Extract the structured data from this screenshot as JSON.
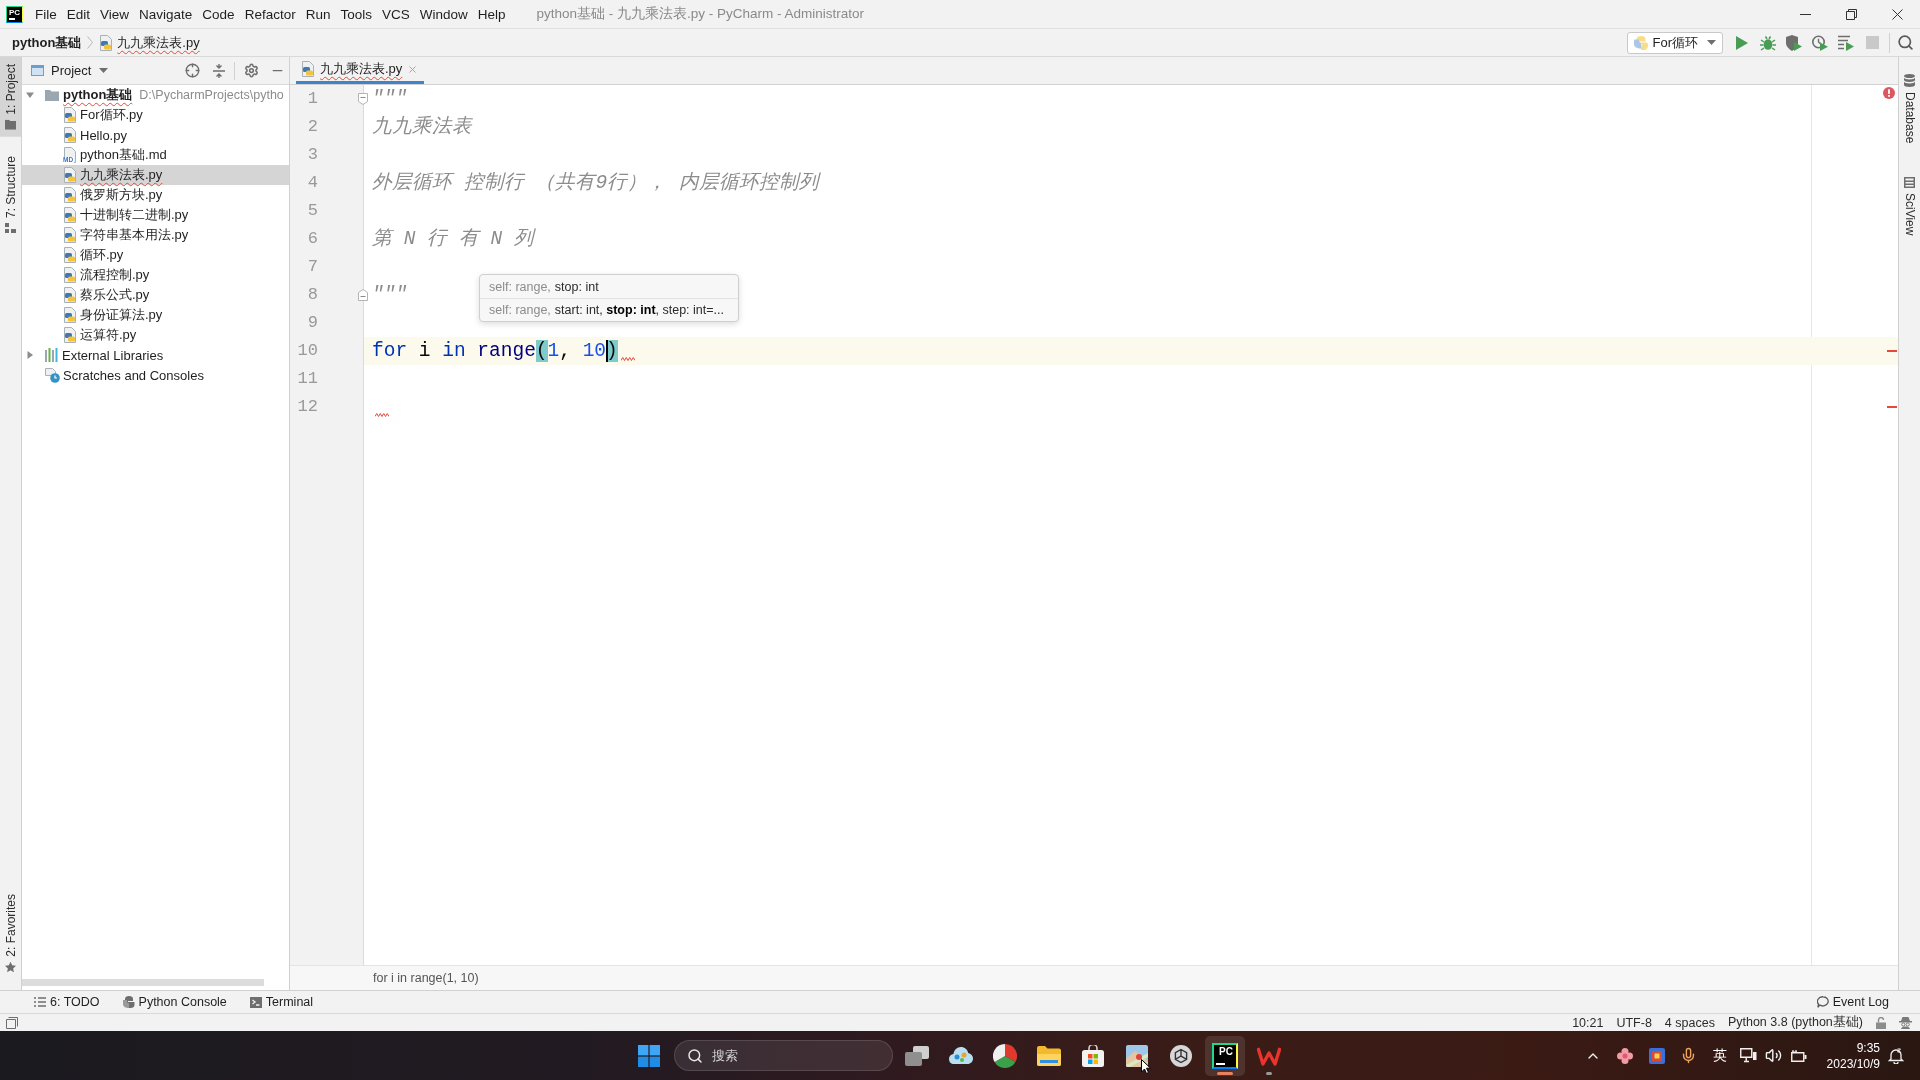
{
  "window": {
    "logo": "PC",
    "title": "python基础 - 九九乘法表.py - PyCharm - Administrator"
  },
  "menu": [
    "File",
    "Edit",
    "View",
    "Navigate",
    "Code",
    "Refactor",
    "Run",
    "Tools",
    "VCS",
    "Window",
    "Help"
  ],
  "navigation_bar": {
    "breadcrumbs": [
      {
        "label": "python基础",
        "kind": "project",
        "error": false
      },
      {
        "label": "九九乘法表.py",
        "kind": "py",
        "error": true
      }
    ],
    "run_configuration": "For循环",
    "actions": [
      {
        "kind": "run",
        "disabled": false
      },
      {
        "kind": "debug",
        "disabled": false
      },
      {
        "kind": "coverage",
        "disabled": false
      },
      {
        "kind": "profile",
        "disabled": false
      },
      {
        "kind": "concurrency",
        "disabled": false
      },
      {
        "kind": "stop",
        "disabled": true
      }
    ]
  },
  "left_stripe": {
    "top": [
      {
        "label": "1: Project",
        "kind": "project",
        "selected": true
      },
      {
        "label": "7: Structure",
        "kind": "structure",
        "selected": false
      }
    ],
    "bottom": [
      {
        "label": "2: Favorites",
        "kind": "favorites",
        "selected": false
      }
    ]
  },
  "project_panel": {
    "title": "Project",
    "tree": [
      {
        "label": "python基础",
        "kind": "folder",
        "path": "D:\\PycharmProjects\\pytho",
        "expanded": true,
        "selected": false,
        "error": true,
        "children": [
          {
            "label": "For循环.py",
            "kind": "py",
            "selected": false,
            "error": false
          },
          {
            "label": "Hello.py",
            "kind": "py",
            "selected": false,
            "error": false
          },
          {
            "label": "python基础.md",
            "kind": "md",
            "icon_text": "MD",
            "selected": false,
            "error": false
          },
          {
            "label": "九九乘法表.py",
            "kind": "py",
            "selected": true,
            "error": true
          },
          {
            "label": "俄罗斯方块.py",
            "kind": "py",
            "selected": false,
            "error": false
          },
          {
            "label": "十进制转二进制.py",
            "kind": "py",
            "selected": false,
            "error": false
          },
          {
            "label": "字符串基本用法.py",
            "kind": "py",
            "selected": false,
            "error": false
          },
          {
            "label": "循环.py",
            "kind": "py",
            "selected": false,
            "error": false
          },
          {
            "label": "流程控制.py",
            "kind": "py",
            "selected": false,
            "error": false
          },
          {
            "label": "蔡乐公式.py",
            "kind": "py",
            "selected": false,
            "error": false
          },
          {
            "label": "身份证算法.py",
            "kind": "py",
            "selected": false,
            "error": false
          },
          {
            "label": "运算符.py",
            "kind": "py",
            "selected": false,
            "error": false
          }
        ]
      },
      {
        "label": "External Libraries",
        "kind": "libraries",
        "expanded": false,
        "selected": false,
        "error": false
      },
      {
        "label": "Scratches and Consoles",
        "kind": "scratches",
        "selected": false,
        "error": false
      }
    ]
  },
  "editor": {
    "tabs": [
      {
        "label": "九九乘法表.py",
        "kind": "py",
        "selected": true,
        "error": true
      }
    ],
    "has_errors": true,
    "lines": [
      {
        "number": "1",
        "kind": "comment",
        "text": "\"\"\"",
        "fold_start": true,
        "fold_end": false,
        "current": false,
        "error": false
      },
      {
        "number": "2",
        "kind": "comment",
        "text": "九九乘法表",
        "fold_start": false,
        "fold_end": false,
        "current": false,
        "error": false
      },
      {
        "number": "3",
        "kind": "blank",
        "fold_start": false,
        "fold_end": false,
        "current": false,
        "error": false
      },
      {
        "number": "4",
        "kind": "comment",
        "text": "外层循环 控制行 （共有9行）， 内层循环控制列",
        "fold_start": false,
        "fold_end": false,
        "current": false,
        "error": false
      },
      {
        "number": "5",
        "kind": "blank",
        "fold_start": false,
        "fold_end": false,
        "current": false,
        "error": false
      },
      {
        "number": "6",
        "kind": "comment",
        "text": "第 N 行 有 N 列",
        "fold_start": false,
        "fold_end": false,
        "current": false,
        "error": false
      },
      {
        "number": "7",
        "kind": "blank",
        "fold_start": false,
        "fold_end": false,
        "current": false,
        "error": false
      },
      {
        "number": "8",
        "kind": "comment",
        "text": "\"\"\"",
        "fold_start": false,
        "fold_end": true,
        "current": false,
        "error": false
      },
      {
        "number": "9",
        "kind": "blank",
        "fold_start": false,
        "fold_end": false,
        "current": false,
        "error": false
      },
      {
        "number": "10",
        "kind": "code",
        "fold_start": false,
        "fold_end": false,
        "current": true,
        "error": true,
        "tokens": [
          {
            "kind": "keyword",
            "text": "for"
          },
          {
            "kind": "plain",
            "text": " i "
          },
          {
            "kind": "keyword",
            "text": "in"
          },
          {
            "kind": "builtin",
            "text": " range"
          },
          {
            "kind": "brace",
            "text": "("
          },
          {
            "kind": "number",
            "text": "1"
          },
          {
            "kind": "plain",
            "text": ", "
          },
          {
            "kind": "number",
            "text": "10"
          },
          {
            "kind": "caret"
          },
          {
            "kind": "brace",
            "text": ")"
          }
        ]
      },
      {
        "number": "11",
        "kind": "blank",
        "fold_start": false,
        "fold_end": false,
        "current": false,
        "error": false
      },
      {
        "number": "12",
        "kind": "blank",
        "fold_start": false,
        "fold_end": false,
        "current": false,
        "error": true
      }
    ],
    "tooltip": {
      "rows": [
        {
          "implicit": "self: range,",
          "params": "stop: int"
        },
        {
          "implicit": "self: range,",
          "params": "start: int, **stop: int**, step: int=..."
        }
      ]
    },
    "breadcrumb": "for i in range(1, 10)"
  },
  "right_stripe": [
    {
      "label": "Database",
      "kind": "database"
    },
    {
      "label": "SciView",
      "kind": "sciview"
    }
  ],
  "tool_windows": [
    {
      "label": "6: TODO",
      "kind": "todo"
    },
    {
      "label": "Python Console",
      "kind": "console"
    },
    {
      "label": "Terminal",
      "kind": "terminal"
    }
  ],
  "event_log": "Event Log",
  "status_bar": [
    "10:21",
    "UTF-8",
    "4 spaces",
    "Python 3.8 (python基础)"
  ],
  "taskbar": {
    "search": {
      "placeholder": "搜索"
    },
    "apps": [
      {
        "kind": "taskview",
        "active": false,
        "running": false,
        "hovered": false
      },
      {
        "kind": "cloud",
        "active": false,
        "running": false,
        "hovered": false
      },
      {
        "kind": "pinwheel",
        "active": false,
        "running": false,
        "hovered": false
      },
      {
        "kind": "folder",
        "active": false,
        "running": false,
        "hovered": false
      },
      {
        "kind": "store",
        "active": false,
        "running": false,
        "hovered": false
      },
      {
        "kind": "photo",
        "active": false,
        "running": false,
        "hovered": true
      },
      {
        "kind": "knot",
        "active": false,
        "running": false,
        "hovered": false
      },
      {
        "kind": "pycharm",
        "logo": "PC",
        "active": true,
        "running": true,
        "hovered": false
      },
      {
        "kind": "wps",
        "active": false,
        "running": true,
        "hovered": false
      }
    ],
    "tray": {
      "input_language": "英",
      "time": "9:35",
      "date": "2023/10/9"
    }
  }
}
